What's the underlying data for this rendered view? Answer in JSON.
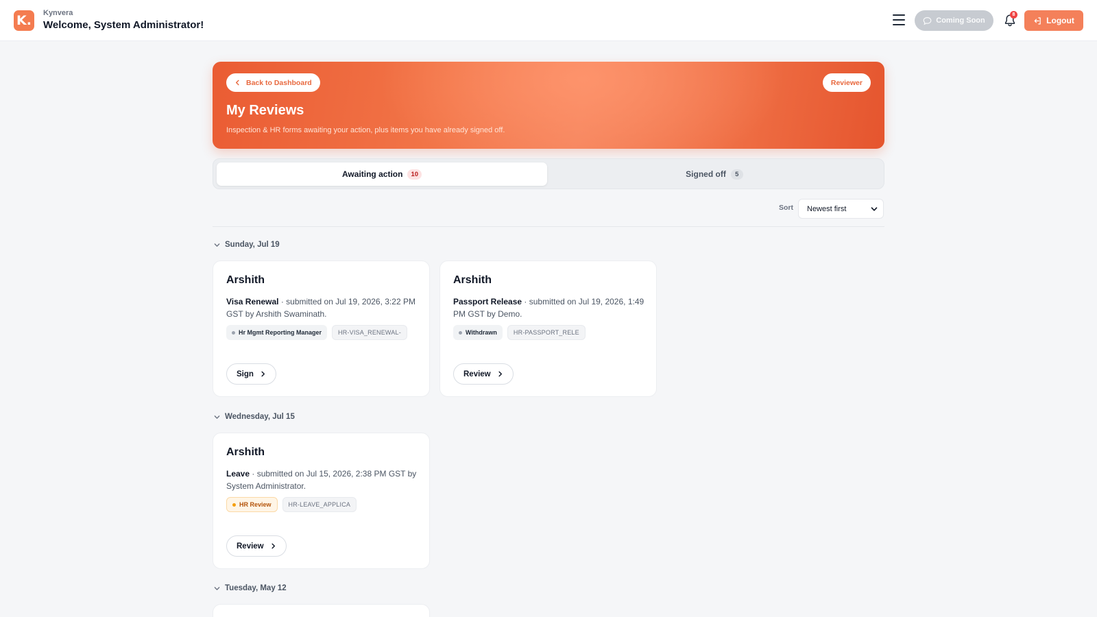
{
  "header": {
    "logo_letter": "K.",
    "brand": "Kynvera",
    "welcome": "Welcome, System Administrator!",
    "coming_soon_label": "Coming Soon",
    "notification_count": "8",
    "logout_label": "Logout"
  },
  "hero": {
    "back_label": "Back to Dashboard",
    "role_label": "Reviewer",
    "title": "My Reviews",
    "subtitle": "Inspection & HR forms awaiting your action, plus items you have already signed off."
  },
  "tabs": [
    {
      "label": "Awaiting action",
      "count": "10",
      "active": true
    },
    {
      "label": "Signed off",
      "count": "5",
      "active": false
    }
  ],
  "sort": {
    "label": "Sort",
    "selected": "Newest first"
  },
  "groups": [
    {
      "date": "Sunday, Jul 19",
      "cards": [
        {
          "name": "Arshith",
          "form": "Visa Renewal",
          "detail": " · submitted on Jul 19, 2026, 3:22 PM GST by Arshith Swaminath.",
          "status": "Hr Mgmt Reporting Manager",
          "code": "HR-VISA_RENEWAL-",
          "action": "Sign"
        },
        {
          "name": "Arshith",
          "form": "Passport Release",
          "detail": " · submitted on Jul 19, 2026, 1:49 PM GST by Demo.",
          "status": "Withdrawn",
          "code": "HR-PASSPORT_RELE",
          "action": "Review"
        }
      ]
    },
    {
      "date": "Wednesday, Jul 15",
      "cards": [
        {
          "name": "Arshith",
          "form": "Leave",
          "detail": " · submitted on Jul 15, 2026, 2:38 PM GST by System Administrator.",
          "status": "HR Review",
          "code": "HR-LEAVE_APPLICA",
          "action": "Review"
        }
      ]
    },
    {
      "date": "Tuesday, May 12",
      "cards": []
    }
  ],
  "colors": {
    "accent": "#f4805a",
    "hero_start": "#ea5c33",
    "hero_end": "#e5552e",
    "badge_red": "#ef4444"
  }
}
